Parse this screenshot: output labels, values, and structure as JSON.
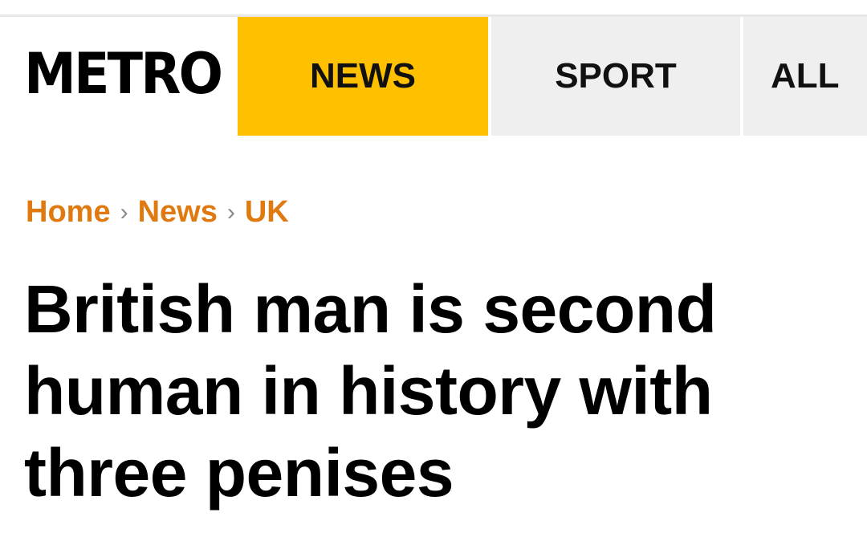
{
  "header": {
    "logo": "METRO",
    "nav": [
      {
        "label": "NEWS"
      },
      {
        "label": "SPORT"
      },
      {
        "label": "ALL"
      }
    ]
  },
  "breadcrumb": {
    "items": [
      "Home",
      "News",
      "UK"
    ],
    "separator": "›"
  },
  "article": {
    "headline_lines": [
      "British man is second",
      "human in history with",
      "three penises"
    ]
  },
  "colors": {
    "accent": "#ffc000",
    "breadcrumb": "#e07a10",
    "nav_bg": "#efefef",
    "text": "#000000"
  }
}
